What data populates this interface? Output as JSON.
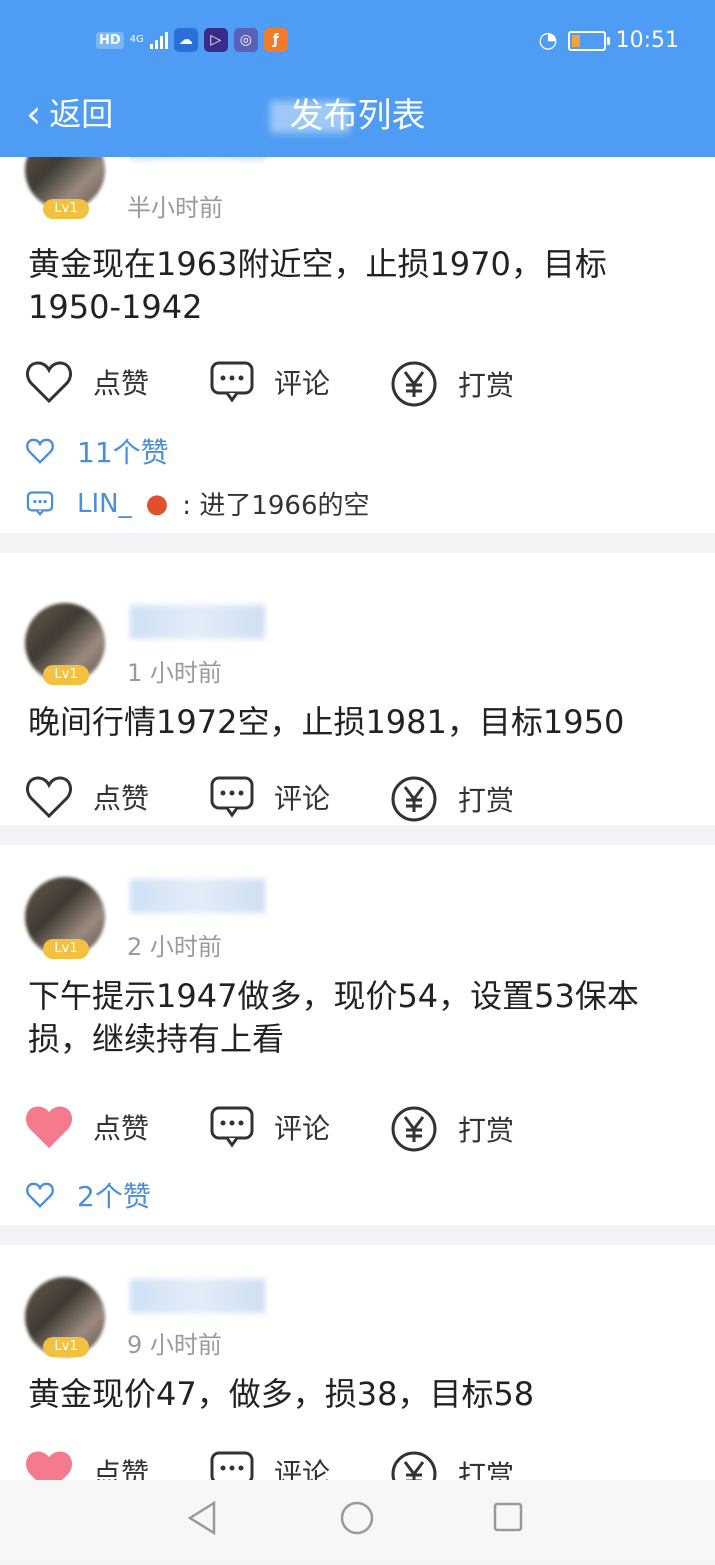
{
  "status_bar": {
    "hd": "HD",
    "network": "4G",
    "time": "10:51"
  },
  "header": {
    "back_label": "返回",
    "title": "发布列表"
  },
  "actions": {
    "like": "点赞",
    "comment": "评论",
    "reward": "打赏"
  },
  "posts": [
    {
      "time": "半小时前",
      "level": "Lv1",
      "content": "黄金现在1963附近空，止损1970，目标1950-1942",
      "liked": false,
      "likes_text": "11个赞",
      "comment_user": "LIN_",
      "comment_text": "进了1966的空"
    },
    {
      "time": "1 小时前",
      "level": "Lv1",
      "content": "晚间行情1972空，止损1981，目标1950",
      "liked": false
    },
    {
      "time": "2 小时前",
      "level": "Lv1",
      "content": "下午提示1947做多，现价54，设置53保本损，继续持有上看",
      "liked": true,
      "likes_text": "2个赞"
    },
    {
      "time": "9 小时前",
      "level": "Lv1",
      "content": "黄金现价47，做多，损38，目标58",
      "liked": true
    }
  ],
  "colors": {
    "header": "#4e9cf3",
    "like_active": "#f47a8e",
    "link": "#4a90d9"
  }
}
